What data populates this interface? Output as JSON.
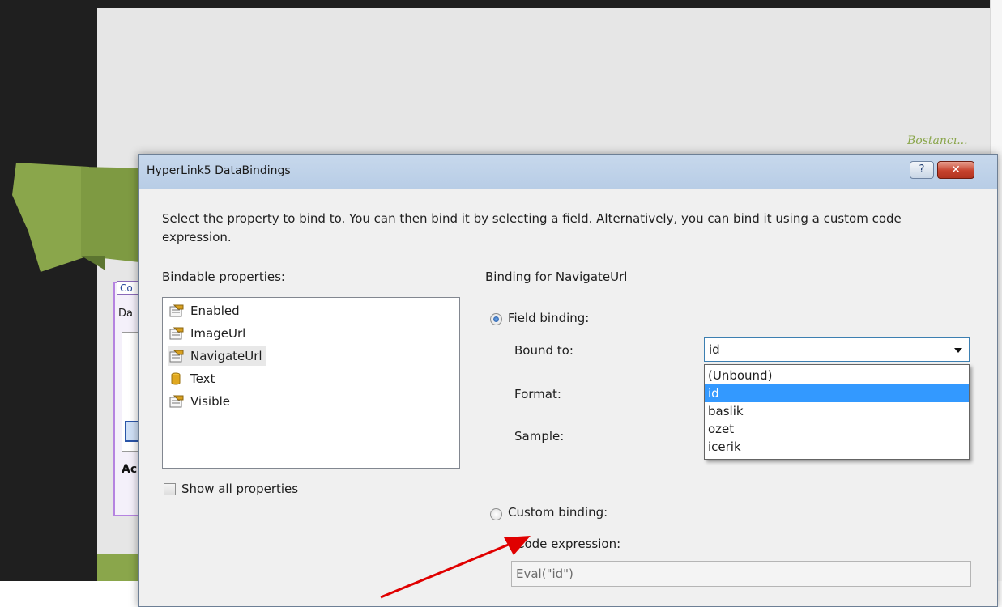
{
  "background": {
    "site_tagline": "Bostancı...",
    "control_tab": "Co",
    "control_row": "Da",
    "control_bottom": "Ac"
  },
  "dialog": {
    "title": "HyperLink5 DataBindings",
    "help_label": "?",
    "close_label": "✕",
    "instruction": "Select the property to bind to. You can then bind it by selecting a field. Alternatively, you can bind it using a custom code expression.",
    "bindable_label": "Bindable properties:",
    "properties": [
      {
        "label": "Enabled",
        "icon": "property-icon"
      },
      {
        "label": "ImageUrl",
        "icon": "property-icon"
      },
      {
        "label": "NavigateUrl",
        "icon": "property-icon",
        "selected": true
      },
      {
        "label": "Text",
        "icon": "database-field-icon"
      },
      {
        "label": "Visible",
        "icon": "property-icon"
      }
    ],
    "show_all_label": "Show all properties",
    "binding_for_label": "Binding for NavigateUrl",
    "field_binding_label": "Field binding:",
    "bound_to_label": "Bound to:",
    "bound_to_value": "id",
    "bound_to_options": [
      "(Unbound)",
      "id",
      "baslik",
      "ozet",
      "icerik"
    ],
    "format_label": "Format:",
    "sample_label": "Sample:",
    "custom_binding_label": "Custom binding:",
    "code_expression_label": "Code expression:",
    "code_expression_value": "Eval(\"id\")"
  },
  "colors": {
    "accent_green": "#8aa64b",
    "selection_blue": "#3399ff",
    "annotation_red": "#e00000",
    "close_red": "#c6422d"
  }
}
